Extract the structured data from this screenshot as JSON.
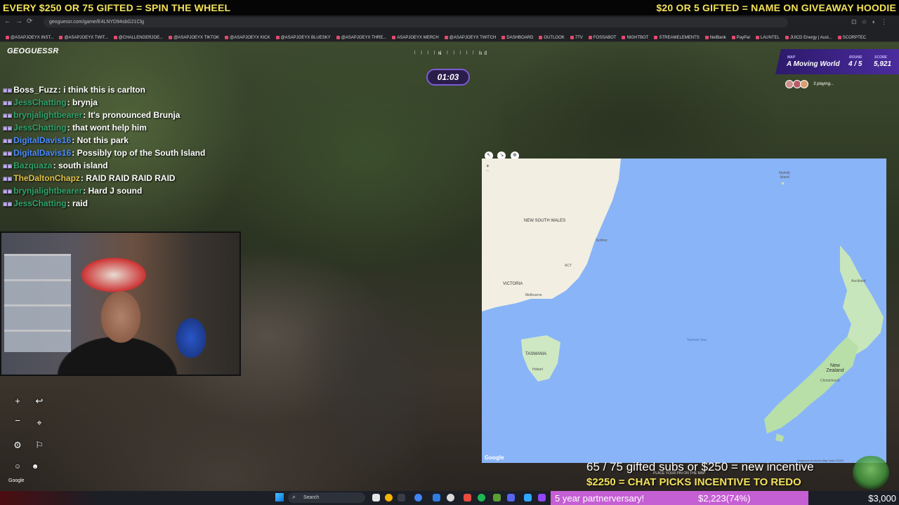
{
  "stream_overlay": {
    "banner_left": "EVERY $250 OR 75 GIFTED = SPIN THE WHEEL",
    "banner_right": "$20 OR 5 GIFTED = NAME ON GIVEAWAY HOODIE",
    "incentive_line1": "65 / 75 gifted subs or $250 = new incentive",
    "incentive_line2": "$2250 = CHAT PICKS INCENTIVE TO REDO"
  },
  "browser": {
    "url": "geoguessr.com/game/E4LNYD94sbG21Clg",
    "bookmarks": [
      "@ASAPJOEYX INST...",
      "@ASAPJOEYX TWIT...",
      "@CHALLENGERJOE...",
      "@ASAPJOEYX TIKTOK",
      "@ASAPJOEYX KICK",
      "@ASAPJOEYX BLUESKY",
      "@ASAPJOEYX THRE...",
      "ASAPJOEYX MERCH",
      "@ASAPJOEYX TWITCH",
      "DASHBOARD",
      "OUTLOOK",
      "7TV",
      "FOSSABOT",
      "NIGHTBOT",
      "STREAMELEMENTS",
      "NetBank",
      "PayPal",
      "LAUNTEL",
      "JUICD Energy | Aust...",
      "SCORPTEC"
    ]
  },
  "game": {
    "logo": "GEOGUESSR",
    "timer": "01:03",
    "compass_n": "N",
    "compass_ne": "NE",
    "map_label": "MAP",
    "map_name": "A Moving World",
    "round_label": "ROUND",
    "round_value": "4 / 5",
    "score_label": "SCORE",
    "score_value": "5,921",
    "players_text": "3 playing...",
    "google_footer": "Google",
    "place_pin_text": "PLACE YOUR PIN ON THE MAP"
  },
  "chat": [
    {
      "user": "Boss_Fuzz",
      "color": "#ffffff",
      "message": "i think this is carlton"
    },
    {
      "user": "JessChatting",
      "color": "#2fa36b",
      "message": "brynja"
    },
    {
      "user": "brynjalightbearer",
      "color": "#2fa36b",
      "message": "It's pronounced Brunja"
    },
    {
      "user": "JessChatting",
      "color": "#2fa36b",
      "message": "that wont help him"
    },
    {
      "user": "DigitalDavis16",
      "color": "#4b8cff",
      "message": "Not this park"
    },
    {
      "user": "DigitalDavis16",
      "color": "#4b8cff",
      "message": "Possibly top of the South Island"
    },
    {
      "user": "Bazquaza",
      "color": "#2fa36b",
      "message": "south island"
    },
    {
      "user": "TheDaltonChapz",
      "color": "#e0c04a",
      "message": "RAID RAID RAID RAID"
    },
    {
      "user": "brynjalightbearer",
      "color": "#2fa36b",
      "message": "Hard J sound"
    },
    {
      "user": "JessChatting",
      "color": "#2fa36b",
      "message": "raid"
    }
  ],
  "map": {
    "labels": {
      "new_south_wales": "NEW SOUTH WALES",
      "sydney": "Sydney",
      "act": "ACT",
      "victoria": "VICTORIA",
      "melbourne": "Melbourne",
      "tasmania": "TASMANIA",
      "hobart": "Hobart",
      "tasman_sea": "Tasman Sea",
      "norfolk_island": "Norfolk Island",
      "auckland": "Auckland",
      "new_zealand": "New Zealand",
      "christchurch": "Christchurch",
      "google": "Google",
      "footer": "Keyboard shortcuts   Map Data ©2025"
    },
    "zoom_plus": "+",
    "zoom_minus": "−"
  },
  "taskbar": {
    "search_placeholder": "Search",
    "partnerversary": "5 year partnerversary!",
    "goal_progress": "$2,223(74%)",
    "goal_target": "$3,000",
    "goal_fraction": 0.74
  },
  "colors": {
    "banner_text": "#f3e25a",
    "score_panel": "#4b2b9e",
    "goal_bar": "#c55fd4",
    "ocean": "#8ab4f8"
  }
}
